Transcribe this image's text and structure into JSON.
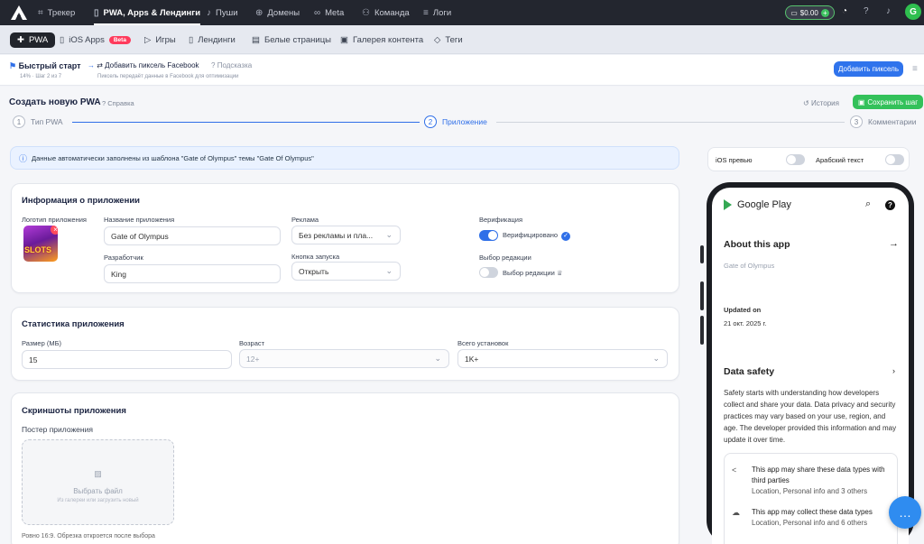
{
  "topbar": {
    "nav": [
      {
        "label": "Трекер",
        "icon": "chart-icon"
      },
      {
        "label": "PWA, Apps & Лендинги",
        "icon": "phone-icon"
      },
      {
        "label": "Пуши",
        "icon": "bell-icon"
      },
      {
        "label": "Домены",
        "icon": "globe-icon"
      },
      {
        "label": "Meta",
        "icon": "infinity-icon"
      },
      {
        "label": "Команда",
        "icon": "team-icon"
      },
      {
        "label": "Логи",
        "icon": "list-icon"
      }
    ],
    "balance": "$0.00",
    "avatar": "G"
  },
  "subnav": {
    "tabs": [
      {
        "label": "PWA"
      },
      {
        "label": "iOS Apps",
        "badge": "Beta"
      },
      {
        "label": "Игры"
      },
      {
        "label": "Лендинги"
      },
      {
        "label": "Белые страницы"
      },
      {
        "label": "Галерея контента"
      },
      {
        "label": "Теги"
      }
    ]
  },
  "quickstart": {
    "title": "Быстрый старт",
    "progress": "14% · Шаг 2 из 7",
    "step_title": "Добавить пиксель Facebook",
    "step_sub": "Пиксель передаёт данные в Facebook для оптимизации",
    "hint": "Подсказка",
    "button": "Добавить пиксель"
  },
  "page": {
    "title": "Создать новую PWA",
    "help": "Справка",
    "history": "История",
    "save": "Сохранить шаг"
  },
  "stepper": [
    {
      "num": "1",
      "label": "Тип PWA"
    },
    {
      "num": "2",
      "label": "Приложение"
    },
    {
      "num": "3",
      "label": "Комментарии"
    }
  ],
  "info_banner": "Данные автоматически заполнены из шаблона \"Gate of Olympus\" темы \"Gate Of Olympus\"",
  "app_info": {
    "title": "Информация о приложении",
    "logo_label": "Логотип приложения",
    "logo_text": "SLOTS",
    "name_label": "Название приложения",
    "name_value": "Gate of Olympus",
    "dev_label": "Разработчик",
    "dev_value": "King",
    "ads_label": "Реклама",
    "ads_value": "Без рекламы и пла...",
    "launch_label": "Кнопка запуска",
    "launch_value": "Открыть",
    "verif_label": "Верификация",
    "verif_value": "Верифицировано",
    "editor_label": "Выбор редакции",
    "editor_value": "Выбор редакции"
  },
  "app_stats": {
    "title": "Статистика приложения",
    "size_label": "Размер (МБ)",
    "size_value": "15",
    "age_label": "Возраст",
    "age_value": "12+",
    "installs_label": "Всего установок",
    "installs_value": "1K+"
  },
  "screenshots": {
    "title": "Скриншоты приложения",
    "poster_label": "Постер приложения",
    "upload_title": "Выбрать файл",
    "upload_sub": "Из галереи или загрузить новый",
    "note": "Ровно 16:9. Обрезка откроется после выбора"
  },
  "preview": {
    "ios_label": "iOS превью",
    "arabic_label": "Арабский текст",
    "store_name": "Google Play",
    "about_title": "About this app",
    "about_sub": "Gate of Olympus",
    "updated_label": "Updated on",
    "updated_value": "21 окт. 2025 г.",
    "safety_title": "Data safety",
    "safety_text": "Safety starts with understanding how developers collect and share your data. Data privacy and security practices may vary based on your use, region, and age. The developer provided this information and may update it over time.",
    "share_title": "This app may share these data types with third parties",
    "share_sub": "Location, Personal info and 3 others",
    "collect_title": "This app may collect these data types",
    "collect_sub": "Location, Personal info and 6 others"
  },
  "colors": {
    "accent": "#2f6fe8",
    "save": "#33c15a",
    "topbar": "#23262f"
  }
}
